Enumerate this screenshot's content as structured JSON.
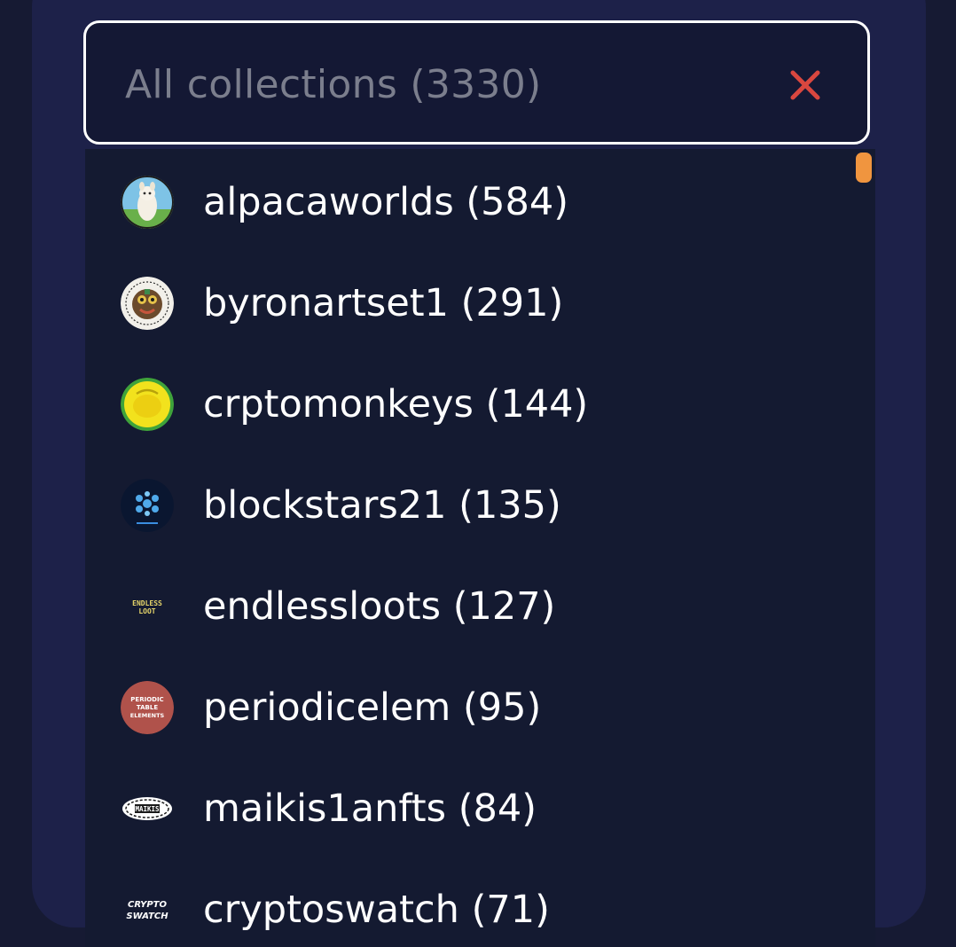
{
  "select": {
    "placeholder": "All collections (3330)",
    "clear_icon": "close-icon",
    "clear_color": "#d9473f"
  },
  "scroll_thumb_color": "#f0953f",
  "collections": [
    {
      "label": "alpacaworlds (584)",
      "icon": "alpaca-logo-icon"
    },
    {
      "label": "byronartset1 (291)",
      "icon": "byronart-logo-icon"
    },
    {
      "label": "crptomonkeys (144)",
      "icon": "monkey-logo-icon"
    },
    {
      "label": "blockstars21 (135)",
      "icon": "blockstars-logo-icon"
    },
    {
      "label": "endlessloots (127)",
      "icon": "endlessloots-logo-icon",
      "logo_text": [
        "ENDLESS",
        "LOOT"
      ]
    },
    {
      "label": "periodicelem (95)",
      "icon": "periodic-table-logo-icon",
      "logo_text": [
        "PERIODIC",
        "TABLE",
        "ELEMENTS"
      ]
    },
    {
      "label": "maikis1anfts (84)",
      "icon": "maikis-logo-icon",
      "logo_text": [
        "MAIKIS"
      ]
    },
    {
      "label": "cryptoswatch (71)",
      "icon": "cryptoswatch-logo-icon",
      "logo_text": [
        "CRYPTO",
        "SWATCH"
      ]
    }
  ]
}
